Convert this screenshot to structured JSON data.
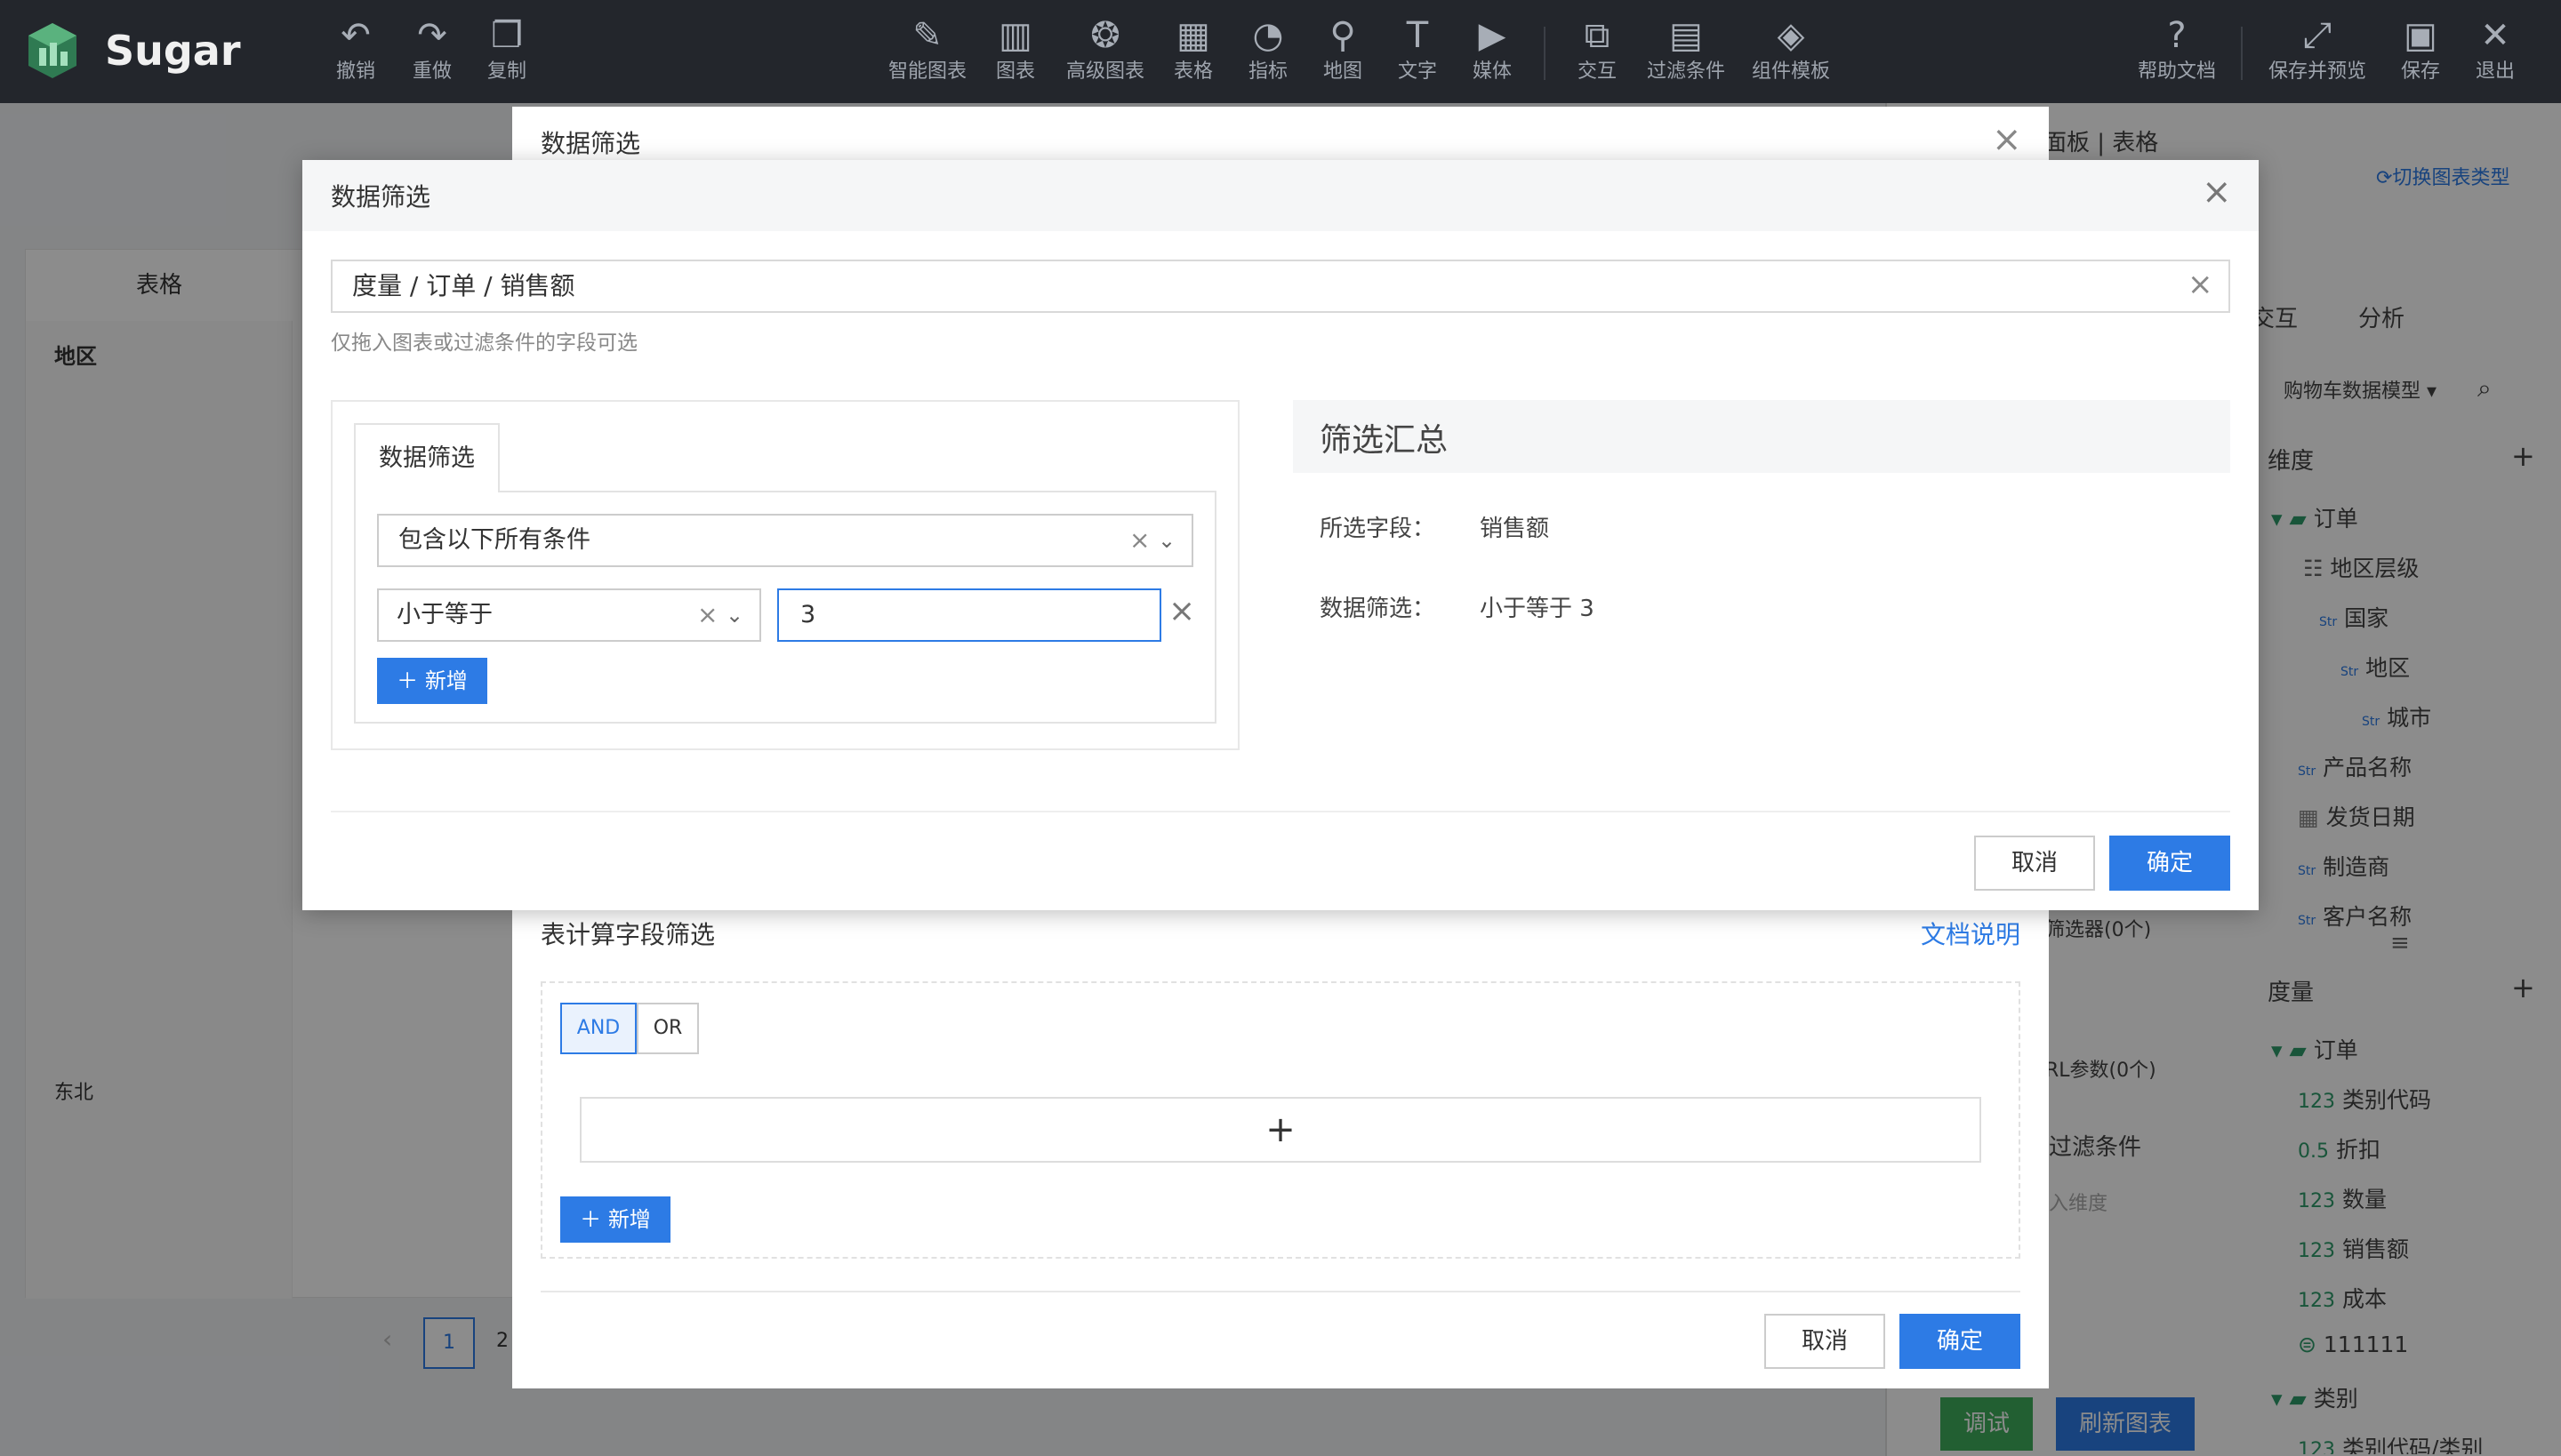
{
  "topbar": {
    "logo_text": "Sugar",
    "left_tools": [
      {
        "label": "撤销",
        "icon": "undo-icon",
        "glyph": "↶"
      },
      {
        "label": "重做",
        "icon": "redo-icon",
        "glyph": "↷"
      },
      {
        "label": "复制",
        "icon": "copy-icon",
        "glyph": "❐"
      }
    ],
    "center_tools": [
      {
        "label": "智能图表",
        "icon": "smart-chart-icon",
        "glyph": "✎"
      },
      {
        "label": "图表",
        "icon": "bar-chart-icon",
        "glyph": "▥"
      },
      {
        "label": "高级图表",
        "icon": "advanced-chart-icon",
        "glyph": "❂"
      },
      {
        "label": "表格",
        "icon": "table-icon",
        "glyph": "▦"
      },
      {
        "label": "指标",
        "icon": "gauge-icon",
        "glyph": "◔"
      },
      {
        "label": "地图",
        "icon": "map-pin-icon",
        "glyph": "⚲"
      },
      {
        "label": "文字",
        "icon": "text-icon",
        "glyph": "T"
      },
      {
        "label": "媒体",
        "icon": "media-icon",
        "glyph": "▶"
      },
      {
        "label": "交互",
        "icon": "interaction-icon",
        "glyph": "⧉"
      },
      {
        "label": "过滤条件",
        "icon": "filter-icon",
        "glyph": "▤"
      },
      {
        "label": "组件模板",
        "icon": "template-icon",
        "glyph": "◈"
      }
    ],
    "right_tools": [
      {
        "label": "帮助文档",
        "icon": "help-icon",
        "glyph": "?"
      },
      {
        "label": "保存并预览",
        "icon": "expand-icon",
        "glyph": "⤢"
      },
      {
        "label": "保存",
        "icon": "save-icon",
        "glyph": "▣"
      },
      {
        "label": "退出",
        "icon": "close-icon",
        "glyph": "✕"
      }
    ]
  },
  "background": {
    "left_panel_title": "表格",
    "column_header": "地区",
    "cell_value": "东北",
    "pager_current": "1",
    "pager_next": "2",
    "right_panel": {
      "breadcrumb": "面板 | 表格",
      "switch_chart_type": "切换图表类型",
      "tab_interaction": "交互",
      "tab_analysis": "分析",
      "data_model": "购物车数据模型",
      "dimension_label": "维度",
      "measure_label": "度量",
      "filter_count": "筛选器(0个)",
      "url_param_count": "RL参数(0个)",
      "filter_condition": "过滤条件",
      "drop_dimension_hint": "入维度",
      "debug_button": "调试",
      "refresh_button": "刷新图表",
      "dimension_tree": [
        {
          "label": "订单",
          "type": "folder"
        },
        {
          "label": "地区层级",
          "type": "hierarchy"
        },
        {
          "label": "国家",
          "type": "Str"
        },
        {
          "label": "地区",
          "type": "Str"
        },
        {
          "label": "城市",
          "type": "Str"
        },
        {
          "label": "产品名称",
          "type": "Str"
        },
        {
          "label": "发货日期",
          "type": "date"
        },
        {
          "label": "制造商",
          "type": "Str"
        },
        {
          "label": "客户名称",
          "type": "Str"
        }
      ],
      "measure_tree": [
        {
          "label": "订单",
          "type": "folder"
        },
        {
          "label": "类别代码",
          "type": "123"
        },
        {
          "label": "折扣",
          "type": "0.5"
        },
        {
          "label": "数量",
          "type": "123"
        },
        {
          "label": "销售额",
          "type": "123"
        },
        {
          "label": "成本",
          "type": "123"
        },
        {
          "label": "111111",
          "type": "calc"
        },
        {
          "label": "类别",
          "type": "folder"
        },
        {
          "label": "类别代码/类别",
          "type": "123"
        }
      ]
    }
  },
  "filter_dialog": {
    "title": "数据筛选",
    "section_title": "表计算字段筛选",
    "doc_link": "文档说明",
    "and_label": "AND",
    "or_label": "OR",
    "add_label": "新增",
    "cancel_label": "取消",
    "ok_label": "确定"
  },
  "data_filter_dialog": {
    "title": "数据筛选",
    "field_path": "度量 / 订单 / 销售额",
    "field_hint": "仅拖入图表或过滤条件的字段可选",
    "tab_label": "数据筛选",
    "condition_mode": "包含以下所有条件",
    "operator": "小于等于",
    "value": "3",
    "add_label": "新增",
    "summary_title": "筛选汇总",
    "selected_field_label": "所选字段：",
    "selected_field_value": "销售额",
    "filter_label": "数据筛选：",
    "filter_value": "小于等于 3",
    "cancel_label": "取消",
    "ok_label": "确定"
  },
  "colors": {
    "primary": "#2d7be5",
    "topbar": "#23262c",
    "success": "#3fae5c"
  }
}
